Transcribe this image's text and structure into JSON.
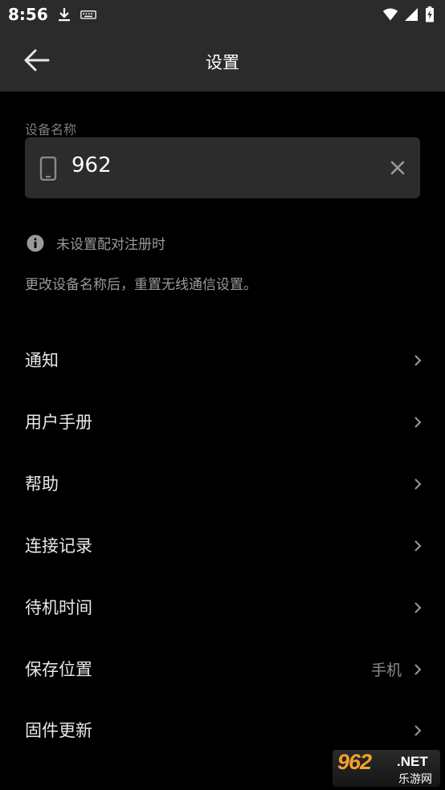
{
  "status_bar": {
    "time": "8:56",
    "icons": [
      "download-icon",
      "keyboard-icon",
      "wifi-icon",
      "signal-icon",
      "battery-charging-icon"
    ]
  },
  "app_bar": {
    "back_icon": "arrow-left-icon",
    "title": "设置"
  },
  "device_name": {
    "section_label": "设备名称",
    "icon": "phone-icon",
    "value": "962",
    "clear_icon": "close-icon"
  },
  "info": {
    "icon": "info-icon",
    "text": "未设置配对注册时",
    "help": "更改设备名称后，重置无线通信设置。"
  },
  "menu": {
    "items": [
      {
        "label": "通知",
        "value": ""
      },
      {
        "label": "用户手册",
        "value": ""
      },
      {
        "label": "帮助",
        "value": ""
      },
      {
        "label": "连接记录",
        "value": ""
      },
      {
        "label": "待机时间",
        "value": ""
      },
      {
        "label": "保存位置",
        "value": "手机"
      },
      {
        "label": "固件更新",
        "value": ""
      }
    ]
  },
  "watermark": {
    "brand": "962",
    "net": ".NET",
    "sub": "乐游网"
  },
  "colors": {
    "background": "#000000",
    "bar": "#2b2b2b",
    "field": "#2c2c2c",
    "text_primary": "#e8e8e8",
    "text_secondary": "#9a9a9a",
    "watermark_accent": "#f2a12c"
  }
}
